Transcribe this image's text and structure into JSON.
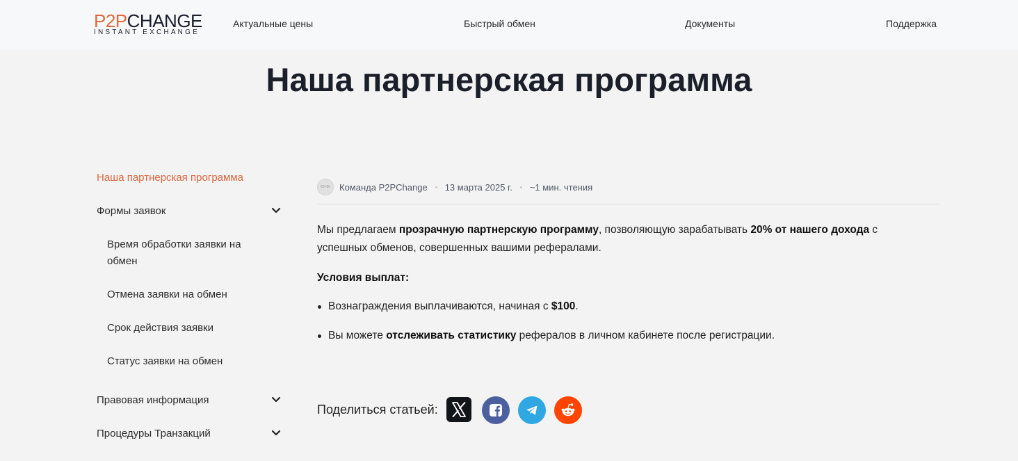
{
  "header": {
    "logo_p2p": "P2P",
    "logo_change": "CHANGE",
    "logo_tagline": "INSTANT EXCHANGE",
    "nav": [
      "Актуальные цены",
      "Быстрый обмен",
      "Документы",
      "Поддержка"
    ]
  },
  "page_title": "Наша партнерская программа",
  "sidebar": {
    "items": [
      {
        "label": "Наша партнерская программа",
        "active": true
      },
      {
        "label": "Формы заявок",
        "expandable": true
      },
      {
        "label": "Время обработки заявки на обмен",
        "sub": true
      },
      {
        "label": "Отмена заявки на обмен",
        "sub": true
      },
      {
        "label": "Срок действия заявки",
        "sub": true
      },
      {
        "label": "Статус заявки на обмен",
        "sub": true
      },
      {
        "label": "Правовая информация",
        "expandable": true
      },
      {
        "label": "Процедуры Транзакций",
        "expandable": true
      }
    ]
  },
  "article": {
    "avatar_text": "80×80",
    "author": "Команда P2PChange",
    "date": "13 марта 2025 г.",
    "read_time": "~1 мин. чтения",
    "intro": {
      "t1": "Мы предлагаем ",
      "b1": "прозрачную партнерскую программу",
      "t2": ", позволяющую зарабатывать ",
      "b2": "20% от нашего дохода",
      "t3": " с успешных обменов, совершенных вашими рефералами."
    },
    "conditions_heading": "Условия выплат:",
    "bullet1": {
      "t1": "Вознаграждения выплачиваются, начиная с ",
      "b1": "$100",
      "t2": "."
    },
    "bullet2": {
      "t1": "Вы можете ",
      "b1": "отслеживать статистику",
      "t2": " рефералов в личном кабинете после регистрации."
    }
  },
  "share": {
    "label": "Поделиться статьей:",
    "icons": [
      "x-icon",
      "facebook-icon",
      "telegram-icon",
      "reddit-icon"
    ]
  },
  "colors": {
    "accent": "#e0653c",
    "background": "#f3f3f3",
    "header_bg": "#f7f8fa",
    "x": "#111418",
    "facebook": "#4c60a0",
    "telegram": "#2ea7e3",
    "reddit": "#ff4500"
  }
}
